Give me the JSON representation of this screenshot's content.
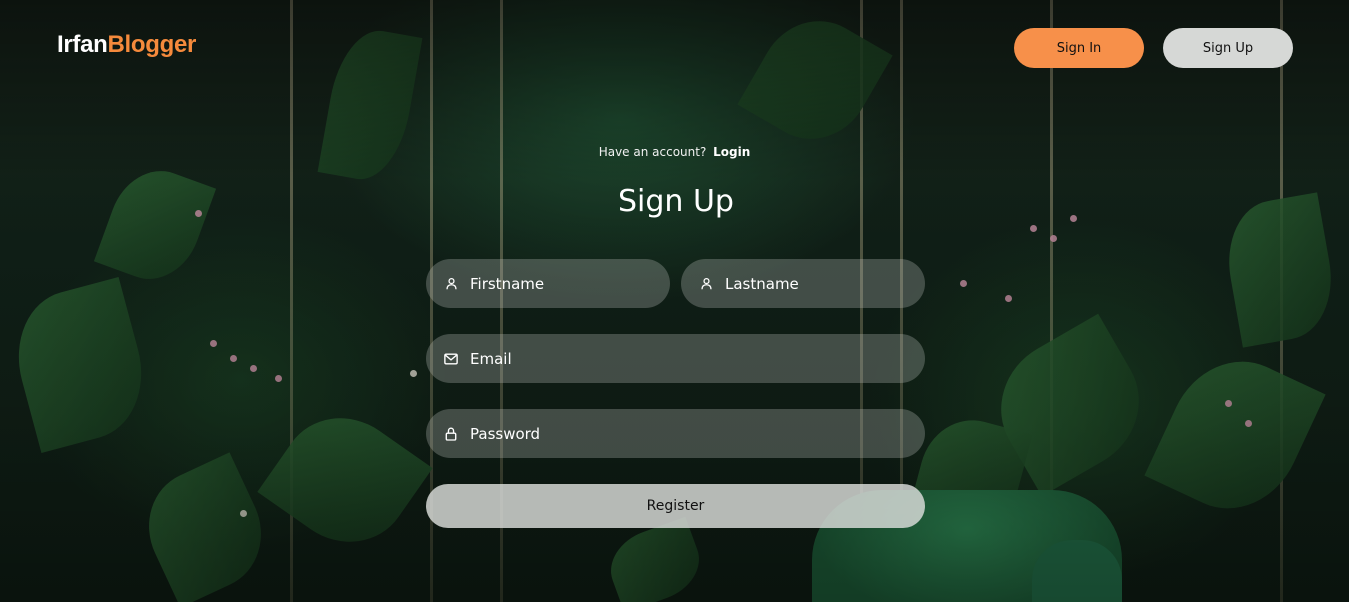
{
  "brand": {
    "name_first": "Irfan",
    "name_second": "Blogger",
    "accent_color": "#f58a3c"
  },
  "nav": {
    "signin_label": "Sign In",
    "signup_label": "Sign Up"
  },
  "form": {
    "have_account_text": "Have an account?",
    "login_link": "Login",
    "title": "Sign Up",
    "firstname_placeholder": "Firstname",
    "lastname_placeholder": "Lastname",
    "email_placeholder": "Email",
    "password_placeholder": "Password",
    "register_label": "Register"
  },
  "icons": {
    "firstname": "user-icon",
    "lastname": "user-icon",
    "email": "envelope-icon",
    "password": "lock-icon"
  }
}
